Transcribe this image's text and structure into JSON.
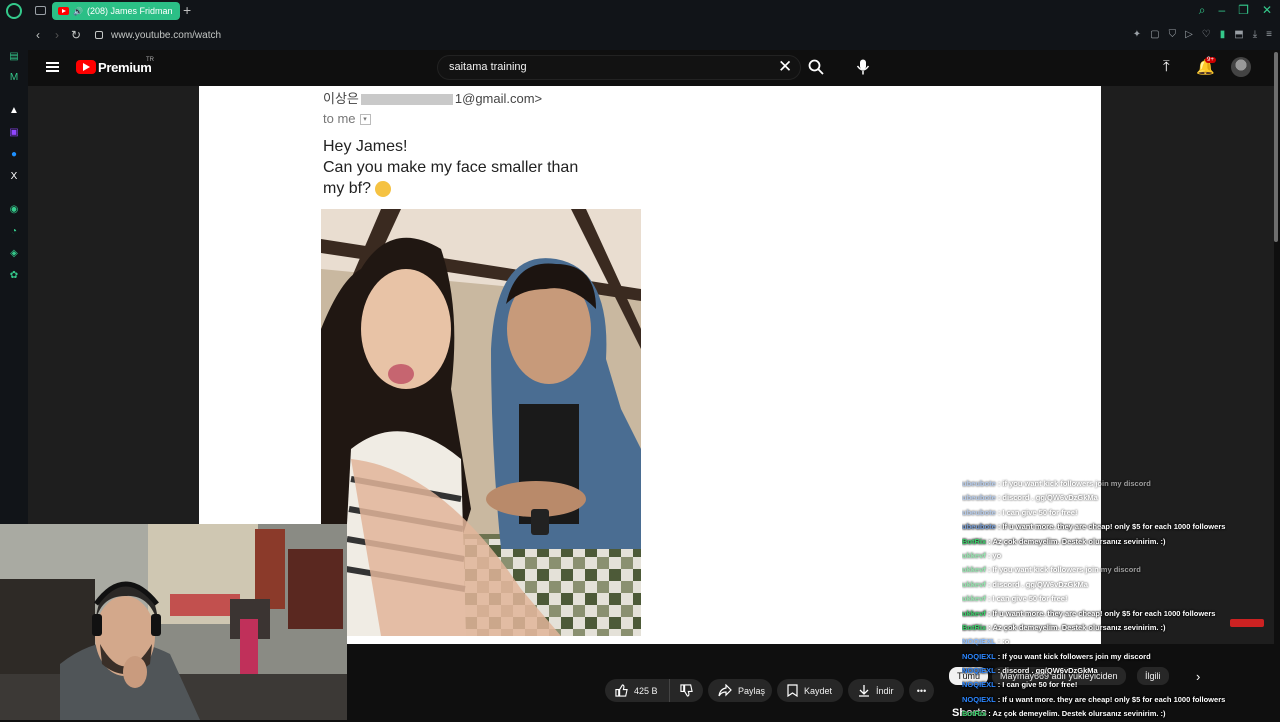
{
  "browser": {
    "tab_title": "(208) James Fridman",
    "url": "www.youtube.com/watch"
  },
  "youtube": {
    "brand": "Premium",
    "region": "TR",
    "search_value": "saitama training",
    "notification_badge": "9+"
  },
  "video": {
    "email_from_prefix": "이상은",
    "email_from_suffix": "1@gmail.com>",
    "email_to": "to me",
    "email_line1": "Hey James!",
    "email_line2": "Can you make my face smaller than",
    "email_line3": "my bf?"
  },
  "actions": {
    "like_count": "425 B",
    "share": "Paylaş",
    "save": "Kaydet",
    "download": "İndir"
  },
  "related": {
    "tab_all": "Tümü",
    "tab_uploader": "Maymay669 adlı yükleyiciden",
    "tab_related": "İlgili",
    "shorts": "Shorts"
  },
  "chat": [
    {
      "user": "ubeubote",
      "msg": " : if you want kick followers join my discord",
      "style": "gray",
      "faded": true
    },
    {
      "user": "ubeubote",
      "msg": " : discord . gg/QW6vDzGkMa",
      "style": "gray",
      "faded": true
    },
    {
      "user": "ubeubote",
      "msg": " : I can give 50 for free!",
      "style": "gray",
      "faded": true
    },
    {
      "user": "ubeubote",
      "msg": " : If u want more. they are cheap! only $5 for each 1000 followers",
      "style": "gray",
      "faded": false
    },
    {
      "user": "BotRix",
      "msg": " : Az çok demeyelim. Destek olursanız sevinirim. :)",
      "style": "green",
      "faded": false
    },
    {
      "user": "ukkevf",
      "msg": " : yo",
      "style": "green",
      "faded": true
    },
    {
      "user": "ukkevf",
      "msg": " : If you want kick followers join my discord",
      "style": "green",
      "faded": true
    },
    {
      "user": "ukkevf",
      "msg": " : discord . gg/QW6vDzGkMa",
      "style": "green",
      "faded": true
    },
    {
      "user": "ukkevf",
      "msg": " : I can give 50 for free!",
      "style": "green",
      "faded": true
    },
    {
      "user": "ukkevf",
      "msg": " : If u want more. they are cheap! only $5 for each 1000 followers",
      "style": "green",
      "faded": false
    },
    {
      "user": "BotRix",
      "msg": " : Az çok demeyelim. Destek olursanız sevinirim. :)",
      "style": "green",
      "faded": false
    },
    {
      "user": "NOQIEXL",
      "msg": " : :o",
      "style": "blue",
      "faded": true
    },
    {
      "user": "NOQIEXL",
      "msg": " : If you want kick followers join my discord",
      "style": "blue",
      "faded": false
    },
    {
      "user": "NOQIEXL",
      "msg": " : discord . gg/QW6vDzGkMa",
      "style": "blue",
      "faded": false
    },
    {
      "user": "NOQIEXL",
      "msg": " : I can give 50 for free!",
      "style": "blue",
      "faded": false
    },
    {
      "user": "NOQIEXL",
      "msg": " : If u want more. they are cheap! only $5 for each 1000 followers",
      "style": "blue",
      "faded": false
    },
    {
      "user": "BotRix",
      "msg": " : Az çok demeyelim. Destek olursanız sevinirim. :)",
      "style": "green",
      "faded": false
    }
  ],
  "colors": {
    "opera_accent": "#34c98b",
    "yt_red": "#ff0000",
    "dark_bg": "#0f0f0f"
  }
}
